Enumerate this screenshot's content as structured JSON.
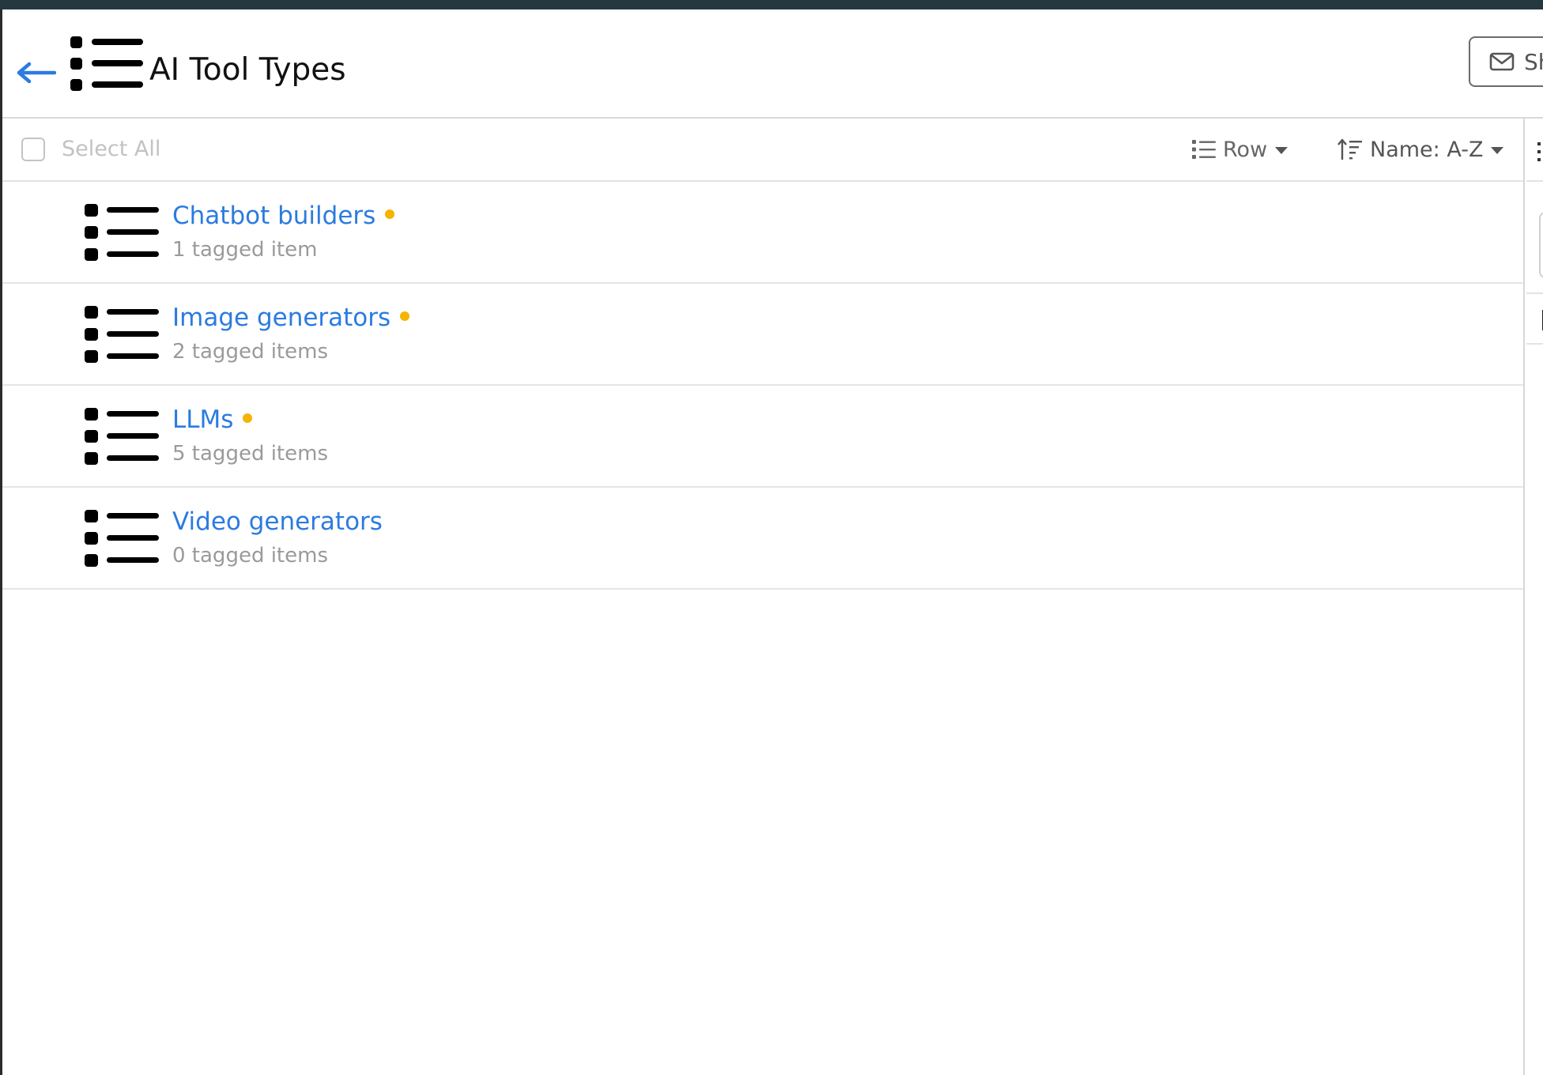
{
  "header": {
    "title": "AI Tool Types",
    "back_icon": "back-arrow-icon",
    "title_icon": "list-icon",
    "share_label": "Sh",
    "share_icon": "envelope-icon"
  },
  "toolbar": {
    "select_all_label": "Select All",
    "view_label": "Row",
    "view_icon": "list-view-icon",
    "sort_label": "Name: A-Z",
    "sort_icon": "sort-ascending-icon"
  },
  "tags": [
    {
      "name": "Chatbot builders",
      "count_text": "1 tagged item",
      "has_dot": true
    },
    {
      "name": "Image generators",
      "count_text": "2 tagged items",
      "has_dot": true
    },
    {
      "name": "LLMs",
      "count_text": "5 tagged items",
      "has_dot": true
    },
    {
      "name": "Video generators",
      "count_text": "0 tagged items",
      "has_dot": false
    }
  ],
  "colors": {
    "topbar": "#26383f",
    "link": "#2b7be0",
    "dot": "#f4b400",
    "muted": "#9a9a9a"
  }
}
